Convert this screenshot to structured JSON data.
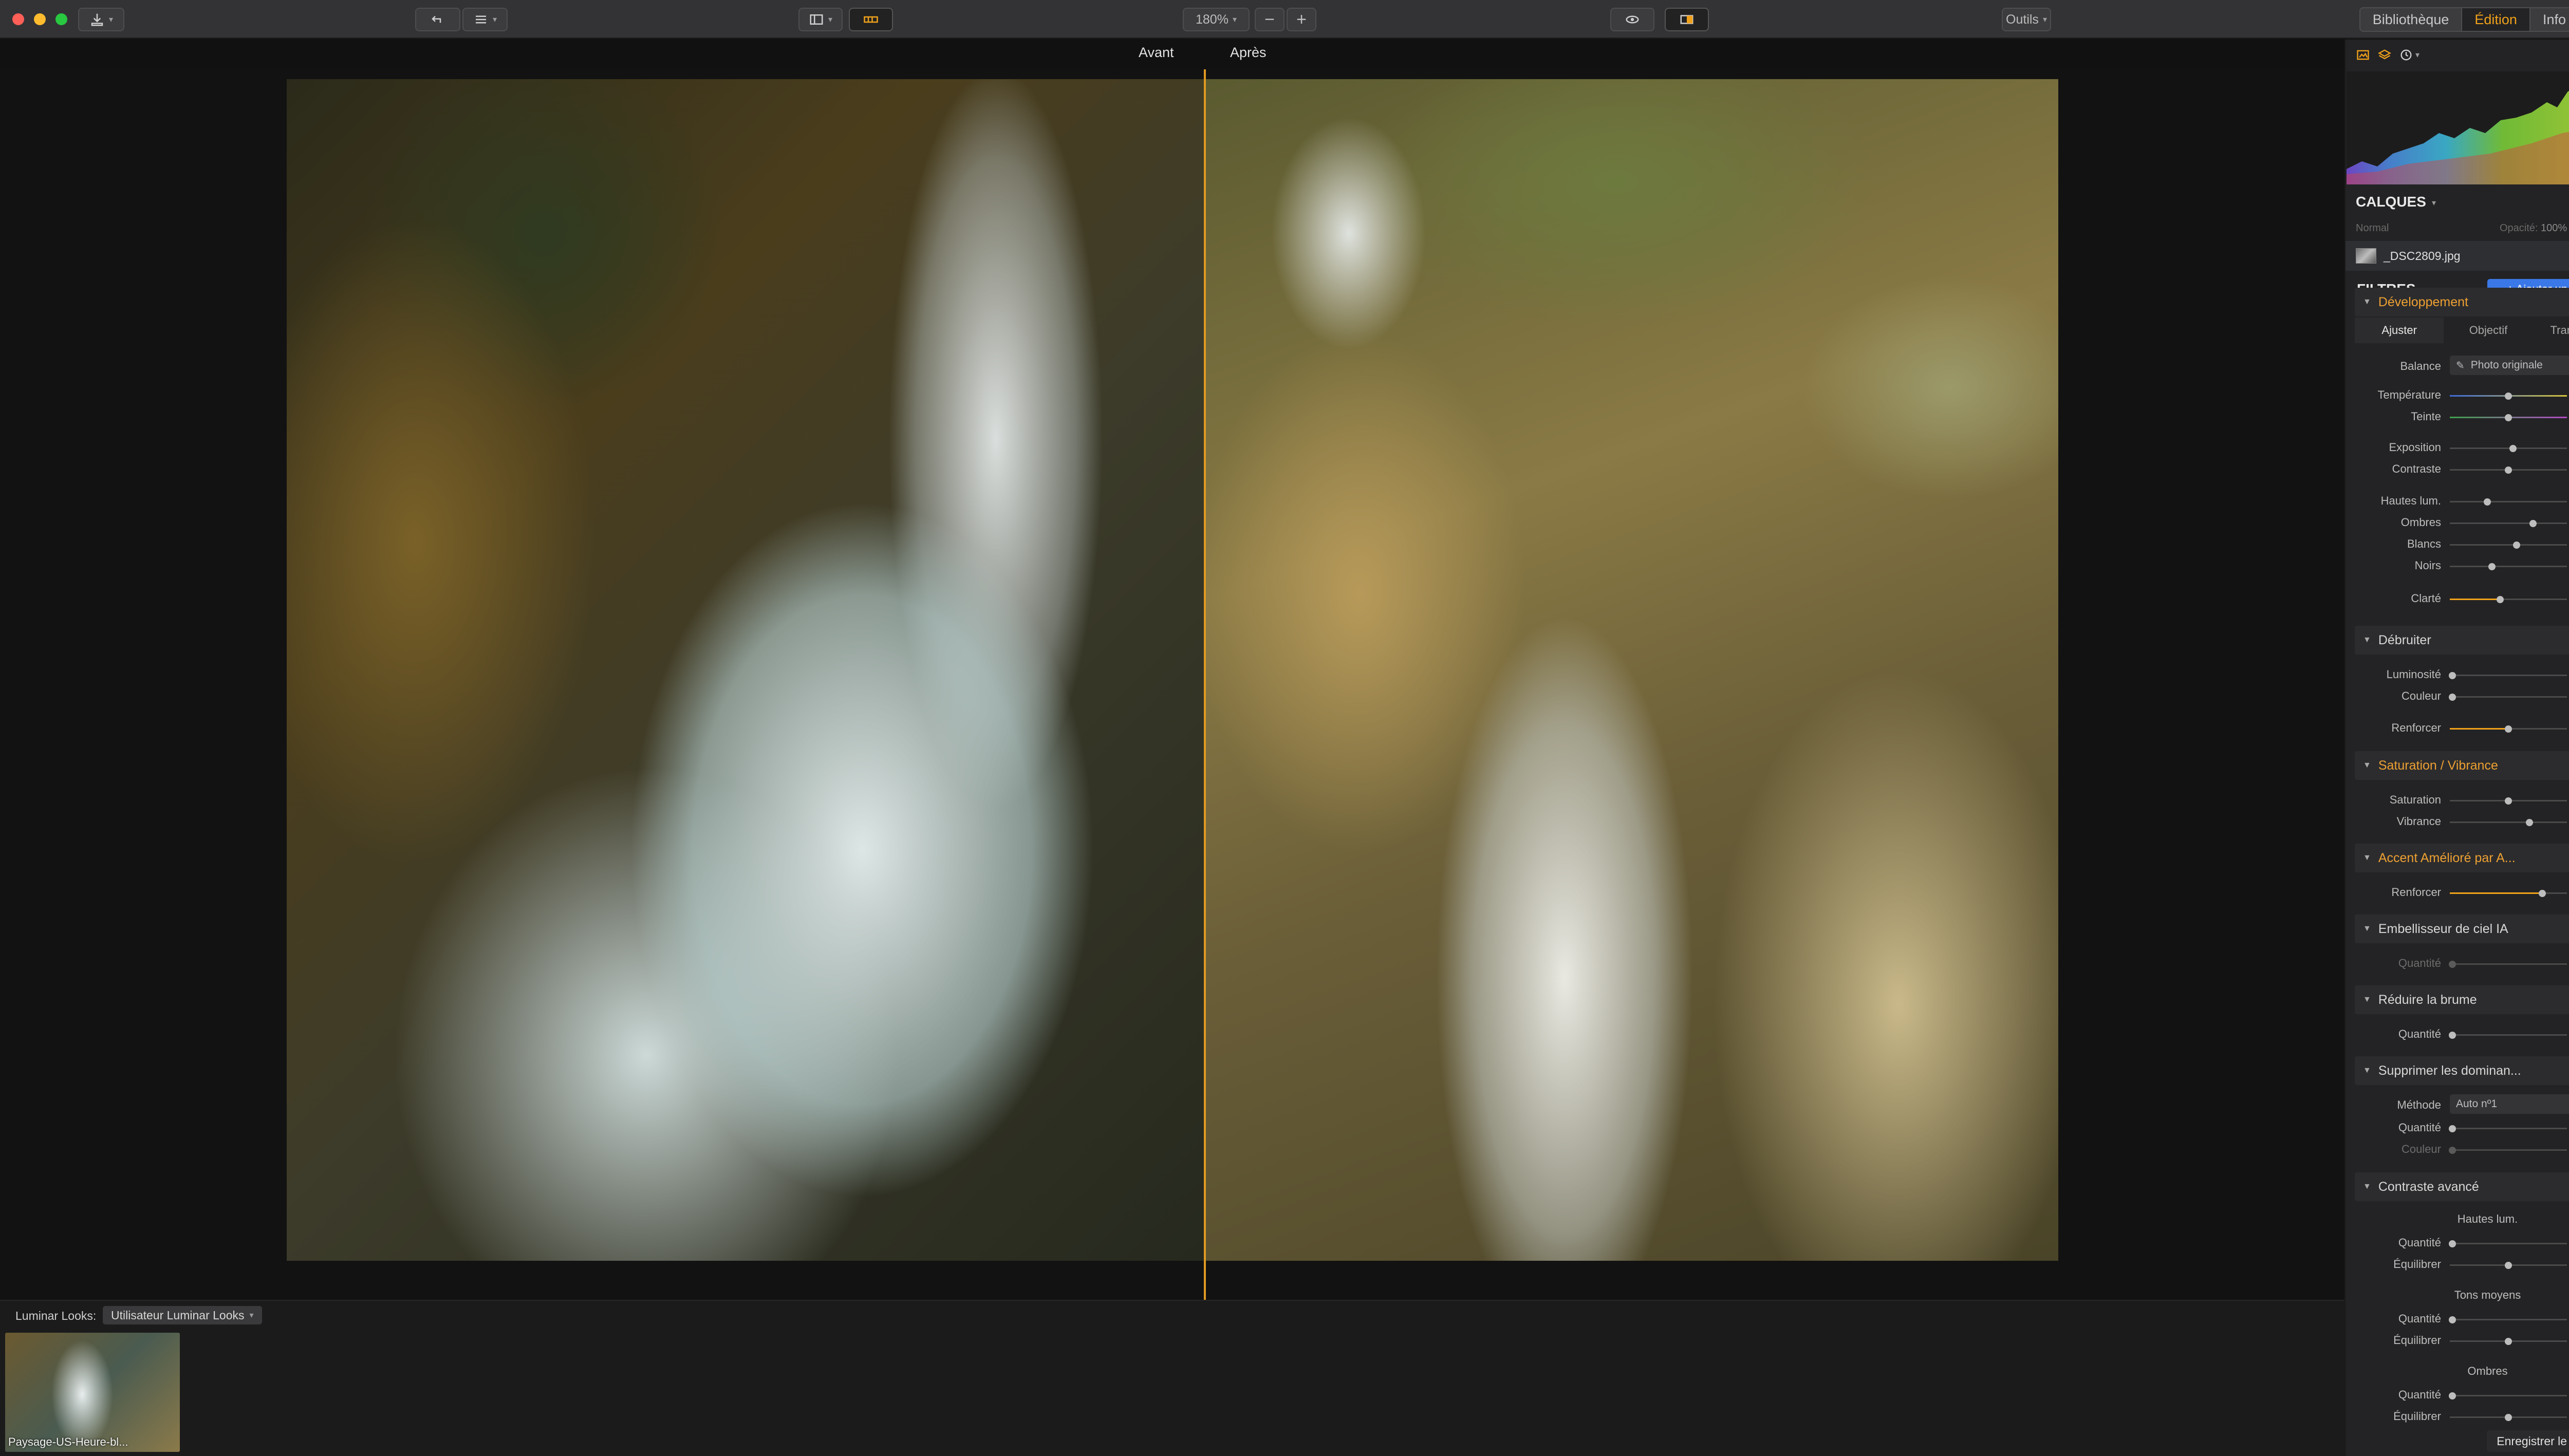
{
  "toolbar": {
    "zoom": "180%",
    "minus": "−",
    "plus": "+",
    "tools_menu": "Outils",
    "tabs": [
      "Bibliothèque",
      "Édition",
      "Info"
    ],
    "active_tab": "Édition"
  },
  "compare": {
    "before": "Avant",
    "after": "Après"
  },
  "looks": {
    "label": "Luminar Looks:",
    "category": "Utilisateur Luminar Looks",
    "items": [
      {
        "name": "Paysage-US-Heure-bl..."
      }
    ],
    "save_button": "Enregistrer le Look L..."
  },
  "layers": {
    "title": "CALQUES",
    "blend_mode": "Normal",
    "opacity_label": "Opacité:",
    "opacity": "100%",
    "file": "_DSC2809.jpg"
  },
  "filters": {
    "title": "FILTRES",
    "add_button": "+ Ajouter un filtre..."
  },
  "development": {
    "title": "Développement",
    "tabs": [
      "Ajuster",
      "Objectif",
      "Transform."
    ],
    "balance_label": "Balance",
    "balance_value": "Photo originale",
    "sliders": [
      {
        "label": "Température",
        "value": "0"
      },
      {
        "label": "Teinte",
        "value": "0"
      },
      {
        "label": "Exposition",
        "value": "0,34"
      },
      {
        "label": "Contraste",
        "value": "0"
      },
      {
        "label": "Hautes lum.",
        "value": "-36"
      },
      {
        "label": "Ombres",
        "value": "42"
      },
      {
        "label": "Blancs",
        "value": "14"
      },
      {
        "label": "Noirs",
        "value": "-28"
      },
      {
        "label": "Clarté",
        "value": "41"
      }
    ]
  },
  "denoise": {
    "title": "Débruiter",
    "sliders": [
      {
        "label": "Luminosité",
        "value": "0"
      },
      {
        "label": "Couleur",
        "value": "0"
      },
      {
        "label": "Renforcer",
        "value": "50"
      }
    ]
  },
  "saturation": {
    "title": "Saturation / Vibrance",
    "sliders": [
      {
        "label": "Saturation",
        "value": "0"
      },
      {
        "label": "Vibrance",
        "value": "36"
      }
    ]
  },
  "accent": {
    "title": "Accent Amélioré par A...",
    "sliders": [
      {
        "label": "Renforcer",
        "value": "79"
      }
    ]
  },
  "sky": {
    "title": "Embellisseur de ciel IA",
    "sliders": [
      {
        "label": "Quantité",
        "value": "0"
      }
    ]
  },
  "haze": {
    "title": "Réduire la brume",
    "sliders": [
      {
        "label": "Quantité",
        "value": "0"
      }
    ]
  },
  "colorcast": {
    "title": "Supprimer les dominan...",
    "method_label": "Méthode",
    "method_value": "Auto nº1",
    "sliders": [
      {
        "label": "Quantité",
        "value": "0"
      },
      {
        "label": "Couleur",
        "value": "0"
      }
    ]
  },
  "advcontrast": {
    "title": "Contraste avancé",
    "groups": [
      {
        "name": "Hautes lum.",
        "sliders": [
          {
            "label": "Quantité",
            "value": "0"
          },
          {
            "label": "Équilibrer",
            "value": "0"
          }
        ]
      },
      {
        "name": "Tons moyens",
        "sliders": [
          {
            "label": "Quantité",
            "value": "0"
          },
          {
            "label": "Équilibrer",
            "value": "0"
          }
        ]
      },
      {
        "name": "Ombres",
        "sliders": [
          {
            "label": "Quantité",
            "value": "0"
          },
          {
            "label": "Équilibrer",
            "value": "0"
          }
        ]
      }
    ]
  },
  "colors": {
    "accent": "#f0a11a",
    "button_blue": "#3b78e7",
    "divider": "#e09a22"
  }
}
